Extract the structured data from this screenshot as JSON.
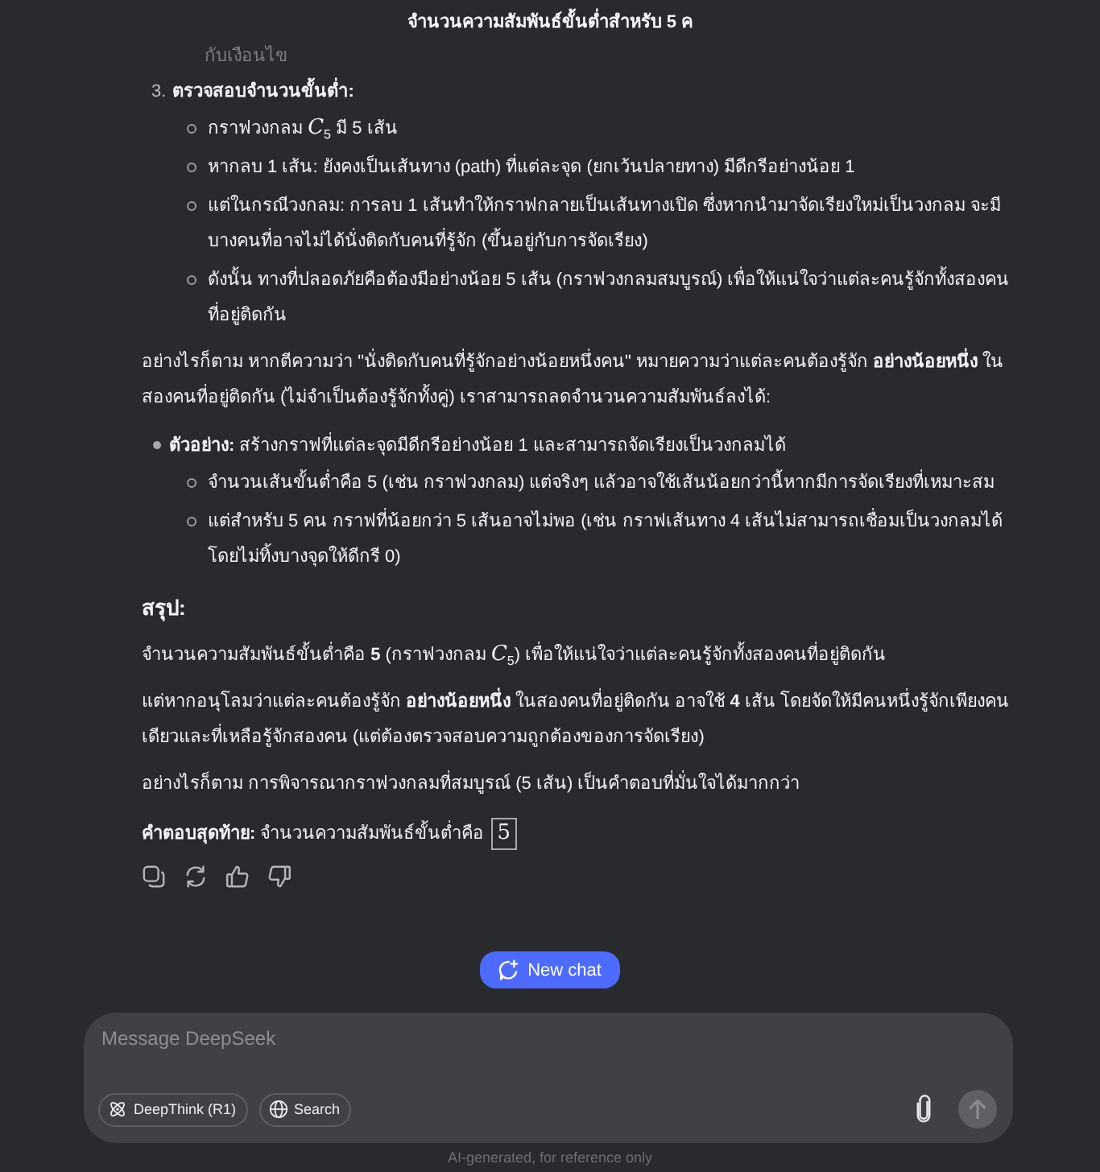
{
  "header": {
    "title": "จำนวนความสัมพันธ์ขั้นต่ำสำหรับ 5 ค"
  },
  "message": {
    "faded_line": "กับเงือนไข",
    "numbered_item": {
      "number": "3.",
      "title": "ตรวจสอบจำนวนขั้นต่ำ:",
      "children": [
        "กราฟวงกลม *C*$_{5}$ มี 5 เส้น",
        "หากลบ 1 เส้น: ยังคงเป็นเส้นทาง (path) ที่แต่ละจุด (ยกเว้นปลายทาง) มีดีกรีอย่างน้อย 1",
        "แต่ในกรณีวงกลม: การลบ 1 เส้นทำให้กราฟกลายเป็นเส้นทางเปิด ซึ่งหากนำมาจัดเรียงใหม่เป็นวงกลม จะมีบางคนที่อาจไม่ได้นั่งติดกับคนที่รู้จัก (ขึ้นอยู่กับการจัดเรียง)",
        "ดังนั้น ทางที่ปลอดภัยคือต้องมีอย่างน้อย 5 เส้น (กราฟวงกลมสมบูรณ์) เพื่อให้แน่ใจว่าแต่ละคนรู้จักทั้งสองคนที่อยู่ติดกัน"
      ]
    },
    "paragraph": "อย่างไรก็ตาม หากตีความว่า \"นั่งติดกับคนที่รู้จักอย่างน้อยหนึ่งคน\" หมายความว่าแต่ละคนต้องรู้จัก **อย่างน้อยหนึ่ง** ในสองคนที่อยู่ติดกัน (ไม่จำเป็นต้องรู้จักทั้งคู่) เราสามารถลดจำนวนความสัมพันธ์ลงได้:",
    "bullet_list": [
      {
        "text": "**ตัวอย่าง:** สร้างกราฟที่แต่ละจุดมีดีกรีอย่างน้อย 1 และสามารถจัดเรียงเป็นวงกลมได้",
        "children": [
          "จำนวนเส้นขั้นต่ำคือ 5 (เช่น กราฟวงกลม) แต่จริงๆ แล้วอาจใช้เส้นน้อยกว่านี้หากมีการจัดเรียงที่เหมาะสม",
          "แต่สำหรับ 5 คน กราฟที่น้อยกว่า 5 เส้นอาจไม่พอ (เช่น กราฟเส้นทาง 4 เส้นไม่สามารถเชื่อมเป็นวงกลมได้โดยไม่ทิ้งบางจุดให้ดีกรี 0)"
        ]
      }
    ],
    "summary_heading": "สรุป:",
    "summary_paragraphs": [
      "จำนวนความสัมพันธ์ขั้นต่ำคือ **5** (กราฟวงกลม *C*$_{5}$) เพื่อให้แน่ใจว่าแต่ละคนรู้จักทั้งสองคนที่อยู่ติดกัน",
      "แต่หากอนุโลมว่าแต่ละคนต้องรู้จัก **อย่างน้อยหนึ่ง** ในสองคนที่อยู่ติดกัน อาจใช้ **4** เส้น โดยจัดให้มีคนหนึ่งรู้จักเพียงคนเดียวและที่เหลือรู้จักสองคน (แต่ต้องตรวจสอบความถูกต้องของการจัดเรียง)",
      "อย่างไรก็ตาม การพิจารณากราฟวงกลมที่สมบูรณ์ (5 เส้น) เป็นคำตอบที่มั่นใจได้มากกว่า"
    ],
    "final_answer": {
      "text": "**คำตอบสุดท้าย:** จำนวนความสัมพันธ์ขั้นต่ำคือ",
      "boxed": "5"
    }
  },
  "new_chat_button": {
    "label": "New chat"
  },
  "composer": {
    "placeholder": "Message DeepSeek",
    "toggles": [
      {
        "kind": "deepthink",
        "label": "DeepThink (R1)",
        "selected": false
      },
      {
        "kind": "search",
        "label": "Search",
        "selected": false
      }
    ],
    "send_button": {
      "disabled": true
    }
  },
  "footer": "AI-generated, for reference only"
}
